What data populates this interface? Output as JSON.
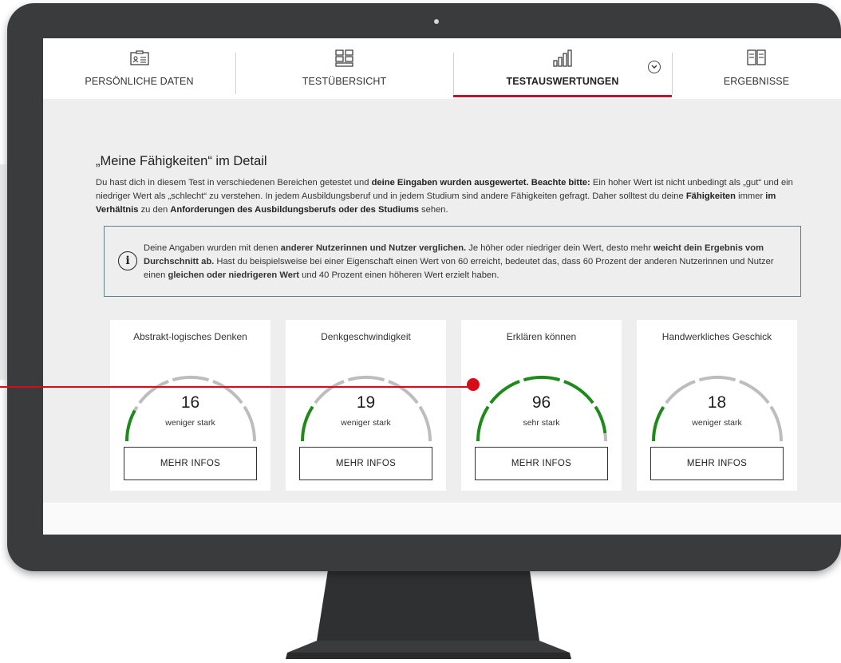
{
  "tabs": [
    {
      "label": "PERSÖNLICHE DATEN",
      "icon": "id-card-icon",
      "active": false
    },
    {
      "label": "TESTÜBERSICHT",
      "icon": "grid-icon",
      "active": false
    },
    {
      "label": "TESTAUSWERTUNGEN",
      "icon": "bar-chart-icon",
      "active": true
    },
    {
      "label": "ERGEBNISSE",
      "icon": "book-icon",
      "active": false
    }
  ],
  "section": {
    "title": "„Meine Fähigkeiten“ im Detail",
    "intro": {
      "p1": "Du hast dich in diesem Test in verschiedenen Bereichen getestet und ",
      "b1": "deine Eingaben wurden ausgewertet.",
      "p2": " ",
      "b2": "Beachte bitte:",
      "p3": " Ein hoher Wert ist nicht unbedingt als „gut“ und ein niedriger Wert als „schlecht“ zu verstehen. In jedem Ausbildungsberuf und in jedem Studium sind andere Fähigkeiten gefragt. Daher solltest du deine ",
      "b3": "Fähigkeiten",
      "p4": " immer ",
      "b4": "im Verhältnis",
      "p5": " zu den ",
      "b5": "Anforderungen des Ausbildungsberufs oder des Studiums",
      "p6": " sehen."
    }
  },
  "info": {
    "p1": "Deine Angaben wurden mit denen ",
    "b1": "anderer Nutzerinnen und Nutzer verglichen.",
    "p2": " Je höher oder niedriger dein Wert, desto mehr ",
    "b2": "weicht dein Ergebnis vom Durchschnitt ab.",
    "p3": " Hast du beispielsweise bei einer Eigenschaft einen Wert von 60 erreicht, bedeutet das, dass 60 Prozent der anderen Nutzerinnen und Nutzer einen ",
    "b3": "gleichen oder niedrigeren Wert",
    "p4": " und 40 Prozent einen höheren Wert erzielt haben."
  },
  "cards": [
    {
      "title": "Abstrakt-logisches Denken",
      "value": "16",
      "level": 16,
      "label": "weniger stark",
      "button": "MEHR INFOS"
    },
    {
      "title": "Denkgeschwindigkeit",
      "value": "19",
      "level": 19,
      "label": "weniger stark",
      "button": "MEHR INFOS"
    },
    {
      "title": "Erklären können",
      "value": "96",
      "level": 96,
      "label": "sehr stark",
      "button": "MEHR INFOS"
    },
    {
      "title": "Handwerkliches Geschick",
      "value": "18",
      "level": 18,
      "label": "weniger stark",
      "button": "MEHR INFOS"
    }
  ],
  "colors": {
    "accent": "#c8102e",
    "gauge_fill": "#1e8a1a",
    "gauge_empty": "#bdbdbd",
    "pointer": "#d80c18"
  }
}
